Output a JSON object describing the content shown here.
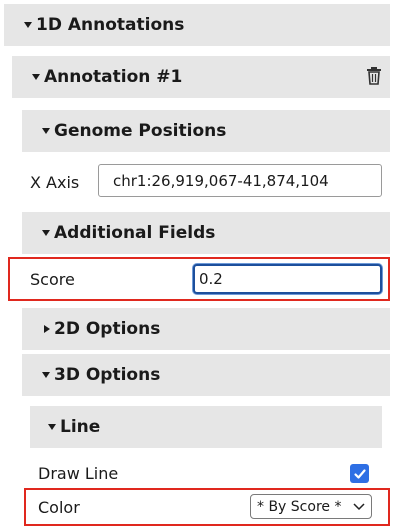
{
  "panel": {
    "annotations_1d": {
      "title": "1D Annotations",
      "annotation": {
        "title": "Annotation #1",
        "genome_positions": {
          "title": "Genome Positions",
          "x_axis_label": "X Axis",
          "x_axis_value": "chr1:26,919,067-41,874,104"
        },
        "additional_fields": {
          "title": "Additional Fields",
          "score_label": "Score",
          "score_value": "0.2"
        },
        "options_2d": {
          "title": "2D Options",
          "expanded": false
        },
        "options_3d": {
          "title": "3D Options",
          "expanded": true,
          "line": {
            "title": "Line",
            "draw_line_label": "Draw Line",
            "draw_line_checked": true,
            "color_label": "Color",
            "color_value": "* By Score *"
          }
        }
      }
    }
  },
  "colors": {
    "header_bg": "#e6e6e6",
    "highlight_red": "#e0281e",
    "checkbox_blue": "#2e6fe4",
    "focus_blue": "#1d4f9c"
  }
}
